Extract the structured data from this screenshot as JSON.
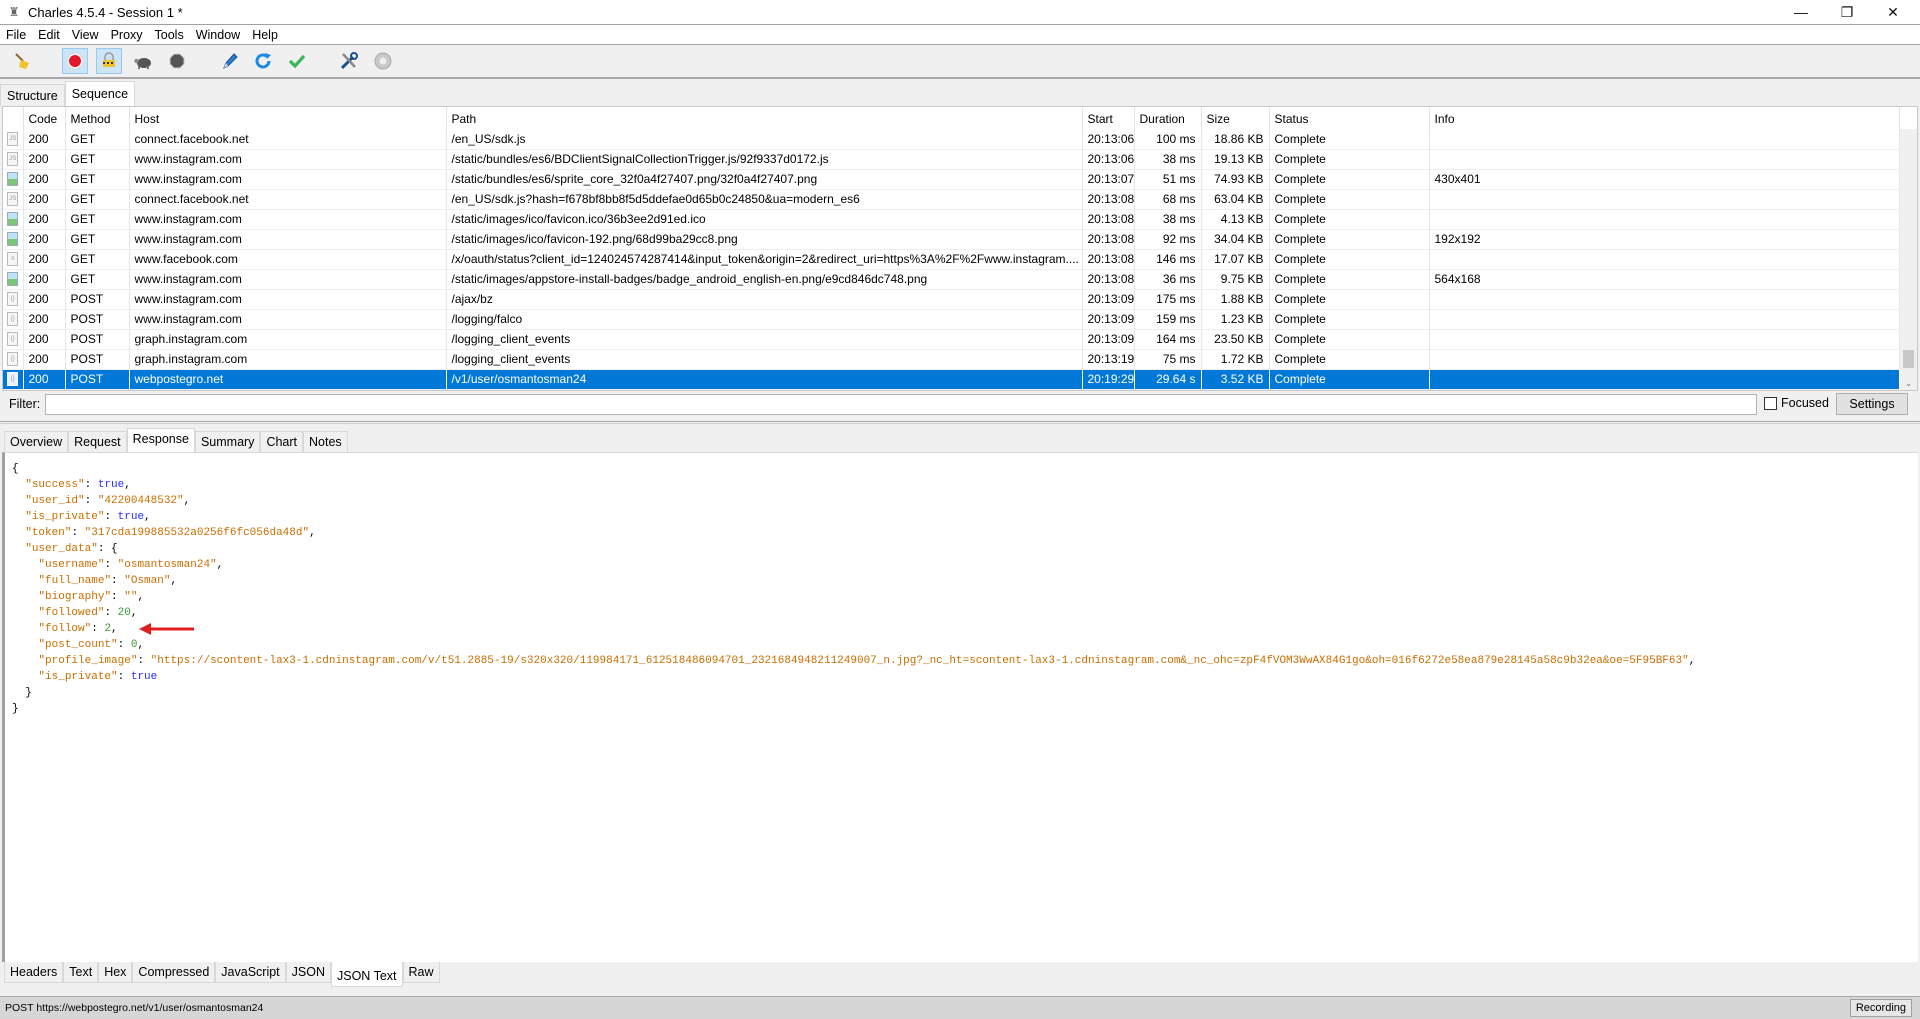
{
  "window": {
    "title": "Charles 4.5.4 - Session 1 *",
    "controls": {
      "minimize": "—",
      "restore": "❐",
      "close": "✕"
    }
  },
  "menu": [
    "File",
    "Edit",
    "View",
    "Proxy",
    "Tools",
    "Window",
    "Help"
  ],
  "toolbar": [
    {
      "name": "broom-icon",
      "tooltip": "Clear Session",
      "active": false
    },
    {
      "name": "record-icon",
      "tooltip": "Start/Stop Recording",
      "active": true
    },
    {
      "name": "ssl-lock-icon",
      "tooltip": "SSL Proxying",
      "active": true
    },
    {
      "name": "turtle-icon",
      "tooltip": "Throttling",
      "active": false
    },
    {
      "name": "breakpoint-stop-icon",
      "tooltip": "Breakpoints",
      "active": false
    },
    {
      "name": "pen-compose-icon",
      "tooltip": "Compose",
      "active": false
    },
    {
      "name": "refresh-repeat-icon",
      "tooltip": "Repeat",
      "active": false
    },
    {
      "name": "checkmark-validate-icon",
      "tooltip": "Validate",
      "active": false
    },
    {
      "name": "tools-icon",
      "tooltip": "Tools",
      "active": false
    },
    {
      "name": "gear-settings-icon",
      "tooltip": "Settings",
      "active": false
    }
  ],
  "session_tabs": [
    {
      "label": "Structure",
      "active": false
    },
    {
      "label": "Sequence",
      "active": true
    }
  ],
  "table": {
    "columns": [
      "",
      "Code",
      "Method",
      "Host",
      "Path",
      "Start",
      "Duration",
      "Size",
      "Status",
      "Info"
    ],
    "rows": [
      {
        "icon": "js",
        "code": "200",
        "method": "GET",
        "host": "connect.facebook.net",
        "path": "/en_US/sdk.js",
        "start": "20:13:06",
        "duration": "100 ms",
        "size": "18.86 KB",
        "status": "Complete",
        "info": ""
      },
      {
        "icon": "js",
        "code": "200",
        "method": "GET",
        "host": "www.instagram.com",
        "path": "/static/bundles/es6/BDClientSignalCollectionTrigger.js/92f9337d0172.js",
        "start": "20:13:06",
        "duration": "38 ms",
        "size": "19.13 KB",
        "status": "Complete",
        "info": ""
      },
      {
        "icon": "img",
        "code": "200",
        "method": "GET",
        "host": "www.instagram.com",
        "path": "/static/bundles/es6/sprite_core_32f0a4f27407.png/32f0a4f27407.png",
        "start": "20:13:07",
        "duration": "51 ms",
        "size": "74.93 KB",
        "status": "Complete",
        "info": "430x401"
      },
      {
        "icon": "js",
        "code": "200",
        "method": "GET",
        "host": "connect.facebook.net",
        "path": "/en_US/sdk.js?hash=f678bf8bb8f5d5ddefae0d65b0c24850&ua=modern_es6",
        "start": "20:13:08",
        "duration": "68 ms",
        "size": "63.04 KB",
        "status": "Complete",
        "info": ""
      },
      {
        "icon": "img",
        "code": "200",
        "method": "GET",
        "host": "www.instagram.com",
        "path": "/static/images/ico/favicon.ico/36b3ee2d91ed.ico",
        "start": "20:13:08",
        "duration": "38 ms",
        "size": "4.13 KB",
        "status": "Complete",
        "info": ""
      },
      {
        "icon": "img",
        "code": "200",
        "method": "GET",
        "host": "www.instagram.com",
        "path": "/static/images/ico/favicon-192.png/68d99ba29cc8.png",
        "start": "20:13:08",
        "duration": "92 ms",
        "size": "34.04 KB",
        "status": "Complete",
        "info": "192x192"
      },
      {
        "icon": "doc",
        "code": "200",
        "method": "GET",
        "host": "www.facebook.com",
        "path": "/x/oauth/status?client_id=124024574287414&input_token&origin=2&redirect_uri=https%3A%2F%2Fwww.instagram....",
        "start": "20:13:08",
        "duration": "146 ms",
        "size": "17.07 KB",
        "status": "Complete",
        "info": ""
      },
      {
        "icon": "img",
        "code": "200",
        "method": "GET",
        "host": "www.instagram.com",
        "path": "/static/images/appstore-install-badges/badge_android_english-en.png/e9cd846dc748.png",
        "start": "20:13:08",
        "duration": "36 ms",
        "size": "9.75 KB",
        "status": "Complete",
        "info": "564x168"
      },
      {
        "icon": "json",
        "code": "200",
        "method": "POST",
        "host": "www.instagram.com",
        "path": "/ajax/bz",
        "start": "20:13:09",
        "duration": "175 ms",
        "size": "1.88 KB",
        "status": "Complete",
        "info": ""
      },
      {
        "icon": "json",
        "code": "200",
        "method": "POST",
        "host": "www.instagram.com",
        "path": "/logging/falco",
        "start": "20:13:09",
        "duration": "159 ms",
        "size": "1.23 KB",
        "status": "Complete",
        "info": ""
      },
      {
        "icon": "json",
        "code": "200",
        "method": "POST",
        "host": "graph.instagram.com",
        "path": "/logging_client_events",
        "start": "20:13:09",
        "duration": "164 ms",
        "size": "23.50 KB",
        "status": "Complete",
        "info": ""
      },
      {
        "icon": "json",
        "code": "200",
        "method": "POST",
        "host": "graph.instagram.com",
        "path": "/logging_client_events",
        "start": "20:13:19",
        "duration": "75 ms",
        "size": "1.72 KB",
        "status": "Complete",
        "info": ""
      },
      {
        "icon": "json",
        "code": "200",
        "method": "POST",
        "host": "webpostegro.net",
        "path": "/v1/user/osmantosman24",
        "start": "20:19:29",
        "duration": "29.64 s",
        "size": "3.52 KB",
        "status": "Complete",
        "info": "",
        "selected": true
      }
    ]
  },
  "filter": {
    "label": "Filter:",
    "value": "",
    "placeholder": "",
    "focused_label": "Focused",
    "focused_checked": false,
    "settings_label": "Settings"
  },
  "detail_tabs": [
    {
      "label": "Overview",
      "active": false
    },
    {
      "label": "Request",
      "active": false
    },
    {
      "label": "Response",
      "active": true
    },
    {
      "label": "Summary",
      "active": false
    },
    {
      "label": "Chart",
      "active": false
    },
    {
      "label": "Notes",
      "active": false
    }
  ],
  "response_json": {
    "lines": [
      {
        "indent": 0,
        "text": "{"
      },
      {
        "indent": 1,
        "key": "success",
        "value": "true",
        "type": "bool",
        "comma": true
      },
      {
        "indent": 1,
        "key": "user_id",
        "value": "\"42200448532\"",
        "type": "string",
        "comma": true
      },
      {
        "indent": 1,
        "key": "is_private",
        "value": "true",
        "type": "bool",
        "comma": true
      },
      {
        "indent": 1,
        "key": "token",
        "value": "\"317cda199885532a0256f6fc056da48d\"",
        "type": "string",
        "comma": true
      },
      {
        "indent": 1,
        "key": "user_data",
        "value": "{",
        "type": "open",
        "comma": false
      },
      {
        "indent": 2,
        "key": "username",
        "value": "\"osmantosman24\"",
        "type": "string",
        "comma": true
      },
      {
        "indent": 2,
        "key": "full_name",
        "value": "\"Osman\"",
        "type": "string",
        "comma": true
      },
      {
        "indent": 2,
        "key": "biography",
        "value": "\"\"",
        "type": "string",
        "comma": true
      },
      {
        "indent": 2,
        "key": "followed",
        "value": "20",
        "type": "number",
        "comma": true
      },
      {
        "indent": 2,
        "key": "follow",
        "value": "2",
        "type": "number",
        "comma": true,
        "annotated": true
      },
      {
        "indent": 2,
        "key": "post_count",
        "value": "0",
        "type": "number",
        "comma": true
      },
      {
        "indent": 2,
        "key": "profile_image",
        "value": "\"https://scontent-lax3-1.cdninstagram.com/v/t51.2885-19/s320x320/119984171_612518486094701_2321684948211249007_n.jpg?_nc_ht=scontent-lax3-1.cdninstagram.com&_nc_ohc=zpF4fVOM3WwAX84G1go&oh=016f6272e58ea879e28145a58c9b32ea&oe=5F95BF63\"",
        "type": "string",
        "comma": true
      },
      {
        "indent": 2,
        "key": "is_private",
        "value": "true",
        "type": "bool",
        "comma": false
      },
      {
        "indent": 1,
        "text": "}"
      },
      {
        "indent": 0,
        "text": "}"
      }
    ],
    "annotation_arrow_color": "#e02020"
  },
  "body_tabs": [
    {
      "label": "Headers",
      "active": false
    },
    {
      "label": "Text",
      "active": false
    },
    {
      "label": "Hex",
      "active": false
    },
    {
      "label": "Compressed",
      "active": false
    },
    {
      "label": "JavaScript",
      "active": false
    },
    {
      "label": "JSON",
      "active": false
    },
    {
      "label": "JSON Text",
      "active": true
    },
    {
      "label": "Raw",
      "active": false
    }
  ],
  "statusbar": {
    "text": "POST https://webpostegro.net/v1/user/osmantosman24",
    "recording_label": "Recording"
  },
  "colors": {
    "selection": "#0078d7",
    "json_key": "#c86e00",
    "json_bool": "#2a2aff",
    "json_number": "#3a9a3a"
  }
}
